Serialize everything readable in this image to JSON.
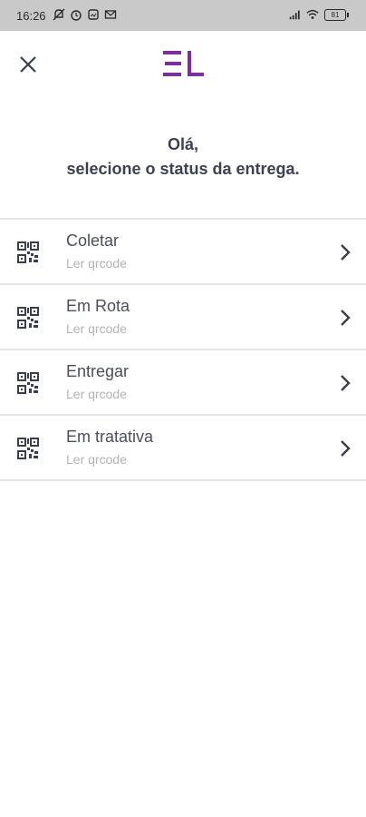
{
  "status_bar": {
    "time": "16:26",
    "battery": "81"
  },
  "header": {
    "close_icon": "close-icon",
    "logo": "EL",
    "logo_color": "#7b2e9c"
  },
  "greeting": {
    "line1": "Olá,",
    "line2": "selecione o status da entrega."
  },
  "items": [
    {
      "label": "Coletar",
      "sub": "Ler qrcode"
    },
    {
      "label": "Em Rota",
      "sub": "Ler qrcode"
    },
    {
      "label": "Entregar",
      "sub": "Ler qrcode"
    },
    {
      "label": "Em tratativa",
      "sub": "Ler qrcode"
    }
  ]
}
